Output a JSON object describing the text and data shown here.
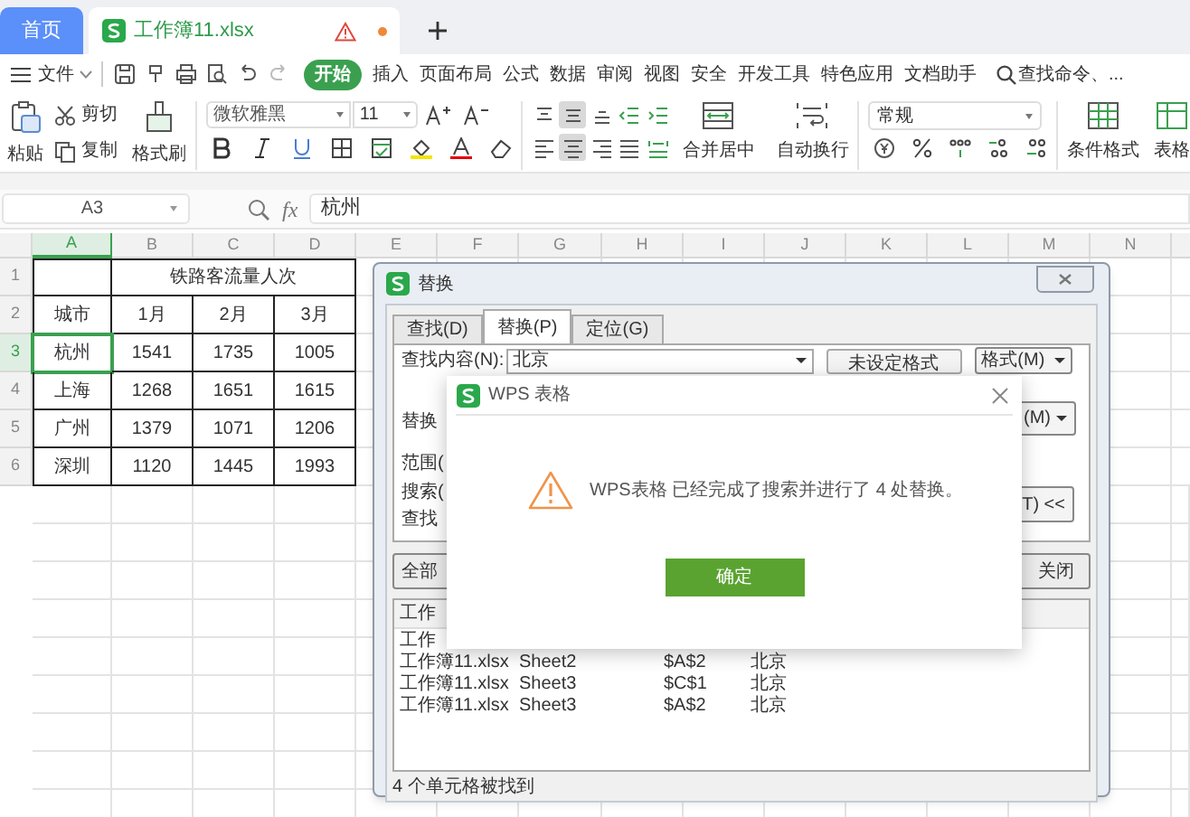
{
  "tabs": [
    {
      "label": "首页",
      "kind": "home",
      "selected": false
    },
    {
      "label": "工作簿11.xlsx",
      "kind": "file",
      "selected": true
    }
  ],
  "menu": {
    "file": "文件",
    "items": [
      {
        "label": "开始",
        "selected": true
      },
      {
        "label": "插入",
        "selected": false
      },
      {
        "label": "页面布局",
        "selected": false
      },
      {
        "label": "公式",
        "selected": false
      },
      {
        "label": "数据",
        "selected": false
      },
      {
        "label": "审阅",
        "selected": false
      },
      {
        "label": "视图",
        "selected": false
      },
      {
        "label": "安全",
        "selected": false
      },
      {
        "label": "开发工具",
        "selected": false
      },
      {
        "label": "特色应用",
        "selected": false
      },
      {
        "label": "文档助手",
        "selected": false
      }
    ],
    "search": "查找命令、..."
  },
  "ribbon": {
    "paste": "粘贴",
    "cut": "剪切",
    "copy": "复制",
    "format_painter": "格式刷",
    "font": "微软雅黑",
    "size": "11",
    "merge": "合并居中",
    "wrap": "自动换行",
    "number_format": "常规",
    "conditional_format": "条件格式",
    "table_style": "表格",
    "alignment": [
      {
        "kind": "top",
        "selected": false
      },
      {
        "kind": "middle",
        "selected": true
      },
      {
        "kind": "bottom",
        "selected": false
      },
      {
        "kind": "outdent",
        "selected": false
      },
      {
        "kind": "indent",
        "selected": false
      },
      {
        "kind": "left",
        "selected": false
      },
      {
        "kind": "center",
        "selected": true
      },
      {
        "kind": "right",
        "selected": false
      },
      {
        "kind": "justify",
        "selected": false
      },
      {
        "kind": "distributed",
        "selected": false
      }
    ]
  },
  "formula_bar": {
    "cell": "A3",
    "fx_label": "fx",
    "value": "杭州"
  },
  "sheet": {
    "columns": [
      {
        "label": "A",
        "selected": true
      },
      {
        "label": "B",
        "selected": false
      },
      {
        "label": "C",
        "selected": false
      },
      {
        "label": "D",
        "selected": false
      },
      {
        "label": "E",
        "selected": false
      },
      {
        "label": "F",
        "selected": false
      },
      {
        "label": "G",
        "selected": false
      },
      {
        "label": "H",
        "selected": false
      },
      {
        "label": "I",
        "selected": false
      },
      {
        "label": "J",
        "selected": false
      },
      {
        "label": "K",
        "selected": false
      },
      {
        "label": "L",
        "selected": false
      },
      {
        "label": "M",
        "selected": false
      },
      {
        "label": "N",
        "selected": false
      }
    ],
    "title": "铁路客流量人次",
    "rows": [
      {
        "number": "1",
        "selected": false,
        "cells": []
      },
      {
        "number": "2",
        "selected": false,
        "cells": [
          "城市",
          "1月",
          "2月",
          "3月"
        ]
      },
      {
        "number": "3",
        "selected": true,
        "cells": [
          "杭州",
          "1541",
          "1735",
          "1005"
        ]
      },
      {
        "number": "4",
        "selected": false,
        "cells": [
          "上海",
          "1268",
          "1651",
          "1615"
        ]
      },
      {
        "number": "5",
        "selected": false,
        "cells": [
          "广州",
          "1379",
          "1071",
          "1206"
        ]
      },
      {
        "number": "6",
        "selected": false,
        "cells": [
          "深圳",
          "1120",
          "1445",
          "1993"
        ]
      }
    ]
  },
  "replace_dialog": {
    "title": "替换",
    "tabs": [
      {
        "label": "查找(D)",
        "selected": false
      },
      {
        "label": "替换(P)",
        "selected": true
      },
      {
        "label": "定位(G)",
        "selected": false
      }
    ],
    "find_label": "查找内容(N):",
    "find_value": "北京",
    "no_format": "未设定格式",
    "format_button": "格式(M)",
    "replace_label": "替换",
    "format_button_2": "(M)",
    "scope_label": "范围(",
    "search_label": "搜索(",
    "look_in_label": "查找",
    "options_button": "T) <<",
    "replace_all_button": "全部",
    "close_button": "关闭",
    "results": {
      "header": "工作",
      "first_row": "工作",
      "rows": [
        [
          "工作簿11.xlsx",
          "Sheet2",
          "$A$2",
          "北京"
        ],
        [
          "工作簿11.xlsx",
          "Sheet3",
          "$C$1",
          "北京"
        ],
        [
          "工作簿11.xlsx",
          "Sheet3",
          "$A$2",
          "北京"
        ]
      ]
    },
    "status": "4 个单元格被找到"
  },
  "message_dialog": {
    "title": "WPS 表格",
    "message": "WPS表格 已经完成了搜索并进行了 4 处替换。",
    "ok_button": "确定"
  }
}
